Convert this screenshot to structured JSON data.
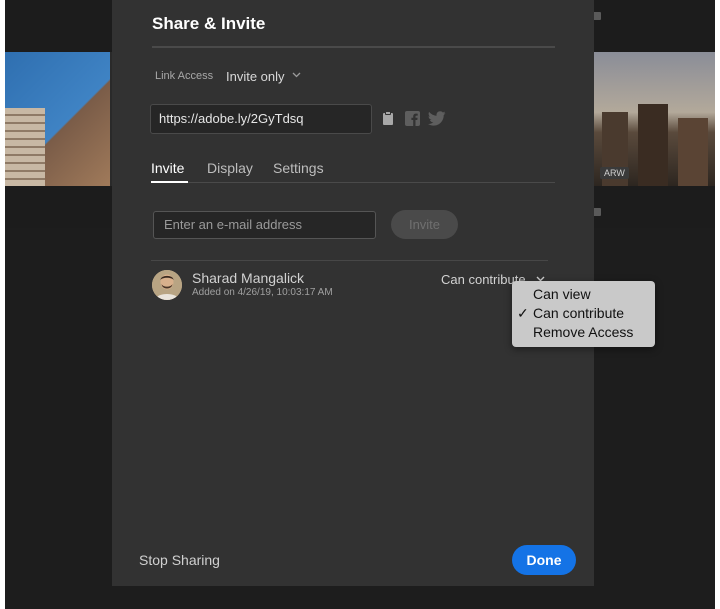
{
  "background": {
    "badge": "ARW"
  },
  "dialog": {
    "title": "Share & Invite",
    "link_access": {
      "label": "Link Access",
      "value": "Invite only"
    },
    "share_url": "https://adobe.ly/2GyTdsq",
    "share_icons": [
      "clipboard-icon",
      "facebook-icon",
      "twitter-icon"
    ],
    "tabs": [
      {
        "label": "Invite",
        "active": true
      },
      {
        "label": "Display",
        "active": false
      },
      {
        "label": "Settings",
        "active": false
      }
    ],
    "invite": {
      "email_placeholder": "Enter an e-mail address",
      "button_label": "Invite"
    },
    "collaborator": {
      "name": "Sharad Mangalick",
      "added": "Added on 4/26/19, 10:03:17 AM",
      "permission": "Can contribute"
    },
    "footer": {
      "stop_sharing": "Stop Sharing",
      "done": "Done"
    }
  },
  "permission_menu": {
    "items": [
      {
        "label": "Can view",
        "checked": false
      },
      {
        "label": "Can contribute",
        "checked": true
      },
      {
        "label": "Remove Access",
        "checked": false
      }
    ],
    "check_glyph": "✓"
  },
  "colors": {
    "accent": "#1473e6",
    "dialog_bg": "#323232",
    "menu_bg": "#c9c9c9"
  }
}
